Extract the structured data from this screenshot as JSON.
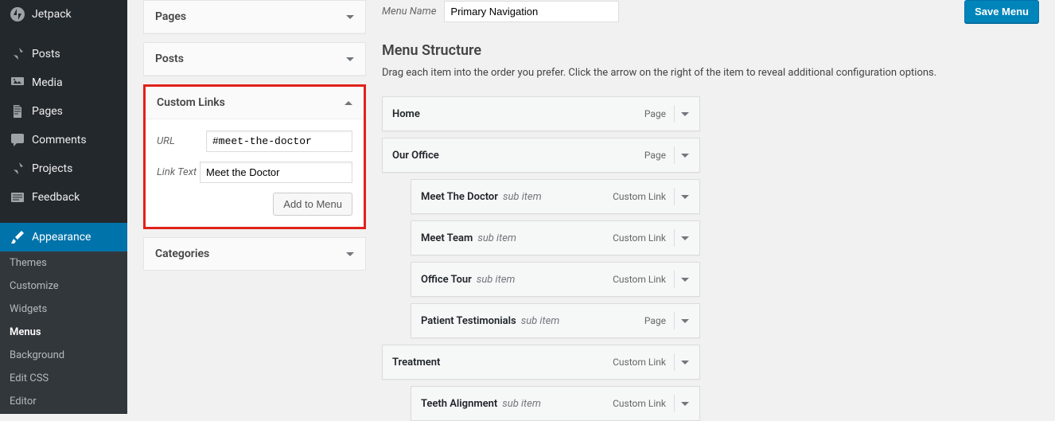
{
  "sidebar": {
    "items": [
      {
        "label": "Jetpack",
        "icon": "jetpack-icon"
      },
      {
        "label": "Posts",
        "icon": "pin-icon"
      },
      {
        "label": "Media",
        "icon": "media-icon"
      },
      {
        "label": "Pages",
        "icon": "page-icon"
      },
      {
        "label": "Comments",
        "icon": "comment-icon"
      },
      {
        "label": "Projects",
        "icon": "pin-icon"
      },
      {
        "label": "Feedback",
        "icon": "feedback-icon"
      },
      {
        "label": "Appearance",
        "icon": "brush-icon"
      }
    ],
    "sub": [
      {
        "label": "Themes"
      },
      {
        "label": "Customize"
      },
      {
        "label": "Widgets"
      },
      {
        "label": "Menus",
        "current": true
      },
      {
        "label": "Background"
      },
      {
        "label": "Edit CSS"
      },
      {
        "label": "Editor"
      }
    ]
  },
  "accordion": {
    "pages": "Pages",
    "posts": "Posts",
    "custom_links": {
      "title": "Custom Links",
      "url_label": "URL",
      "url_value": "#meet-the-doctor",
      "text_label": "Link Text",
      "text_value": "Meet the Doctor",
      "add_btn": "Add to Menu"
    },
    "categories": "Categories"
  },
  "top": {
    "menu_name_label": "Menu Name",
    "menu_name_value": "Primary Navigation",
    "save_btn": "Save Menu"
  },
  "structure": {
    "title": "Menu Structure",
    "hint": "Drag each item into the order you prefer. Click the arrow on the right of the item to reveal additional configuration options.",
    "items": [
      {
        "title": "Home",
        "type": "Page",
        "sub": false
      },
      {
        "title": "Our Office",
        "type": "Page",
        "sub": false
      },
      {
        "title": "Meet The Doctor",
        "type": "Custom Link",
        "sub": true
      },
      {
        "title": "Meet Team",
        "type": "Custom Link",
        "sub": true
      },
      {
        "title": "Office Tour",
        "type": "Custom Link",
        "sub": true
      },
      {
        "title": "Patient Testimonials",
        "type": "Page",
        "sub": true
      },
      {
        "title": "Treatment",
        "type": "Custom Link",
        "sub": false
      },
      {
        "title": "Teeth Alignment",
        "type": "Custom Link",
        "sub": true
      }
    ],
    "sub_item_tag": "sub item"
  }
}
